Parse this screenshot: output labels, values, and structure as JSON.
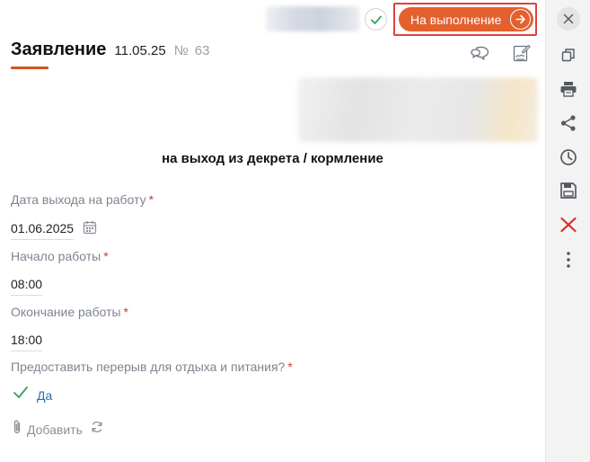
{
  "status": {
    "button_label": "На выполнение",
    "accent_color": "#e4602f",
    "check_icon": "check-circle-icon"
  },
  "document": {
    "title": "Заявление",
    "date": "11.05.25",
    "number_sign": "№",
    "number": "63",
    "subject": "на выход из декрета / кормление"
  },
  "form": {
    "return_date": {
      "label": "Дата выхода на работу",
      "required": "*",
      "value": "01.06.2025"
    },
    "work_start": {
      "label": "Начало работы",
      "required": "*",
      "value": "08:00"
    },
    "work_end": {
      "label": "Окончание работы",
      "required": "*",
      "value": "18:00"
    },
    "break_option": {
      "label": "Предоставить перерыв для отдыха и питания?",
      "required": "*",
      "value": "Да"
    }
  },
  "attachments": {
    "add_label": "Добавить"
  },
  "toolbar_icons": [
    "close-icon",
    "copy-icon",
    "print-icon",
    "share-icon",
    "history-icon",
    "save-icon",
    "delete-icon",
    "more-icon"
  ],
  "header_icons": [
    "comments-icon",
    "sign-icon"
  ]
}
